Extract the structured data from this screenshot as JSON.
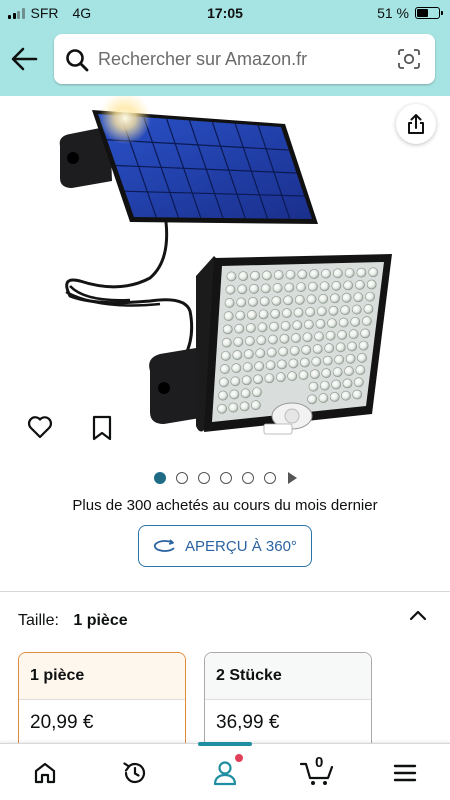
{
  "status": {
    "carrier": "SFR",
    "network": "4G",
    "time": "17:05",
    "battery_text": "51 %",
    "battery_level": 0.51
  },
  "search": {
    "placeholder": "Rechercher sur Amazon.fr"
  },
  "icons": {
    "back": "arrow-left-icon",
    "search": "magnifier-icon",
    "camera": "camera-scan-icon",
    "share": "share-icon",
    "favorite": "heart-icon",
    "save": "bookmark-icon",
    "rotate": "rotate-360-icon",
    "collapse": "chevron-up-icon"
  },
  "product": {
    "image_alt": "solar-led-light-image",
    "carousel_total": 6,
    "carousel_active_index": 0,
    "bought_text": "Plus de 300 achetés au cours du mois dernier",
    "view_360_label": "APERÇU À 360°"
  },
  "size": {
    "label": "Taille:",
    "selected_value": "1 pièce",
    "options": [
      {
        "name": "1 pièce",
        "price": "20,99 €",
        "selected": true
      },
      {
        "name": "2 Stücke",
        "price": "36,99 €",
        "selected": false
      }
    ]
  },
  "bottom_nav": {
    "items": [
      "home-icon",
      "history-icon",
      "account-icon",
      "cart-icon",
      "menu-icon"
    ],
    "cart_count": "0",
    "active": "account-icon"
  },
  "colors": {
    "header_bg": "#a6e4e3",
    "link_blue": "#2b63a0",
    "selected_border": "#e08a3c",
    "active_teal": "#1f8ea0"
  }
}
